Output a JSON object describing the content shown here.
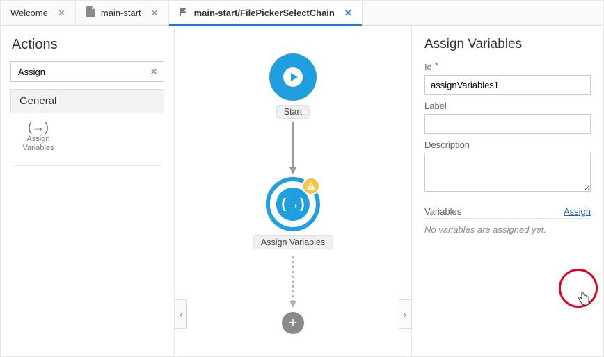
{
  "tabs": [
    {
      "label": "Welcome",
      "icon": null,
      "active": false
    },
    {
      "label": "main-start",
      "icon": "file",
      "active": false
    },
    {
      "label": "main-start/FilePickerSelectChain",
      "icon": "flag",
      "active": true
    }
  ],
  "left": {
    "title": "Actions",
    "search_value": "Assign",
    "group": "General",
    "palette_item": "Assign\nVariables"
  },
  "canvas": {
    "start_label": "Start",
    "assign_label": "Assign Variables"
  },
  "inspector": {
    "title": "Assign Variables",
    "id_label": "Id",
    "id_value": "assignVariables1",
    "label_label": "Label",
    "label_value": "",
    "desc_label": "Description",
    "desc_value": "",
    "vars_label": "Variables",
    "assign_link": "Assign",
    "empty_msg": "No variables are assigned yet."
  }
}
